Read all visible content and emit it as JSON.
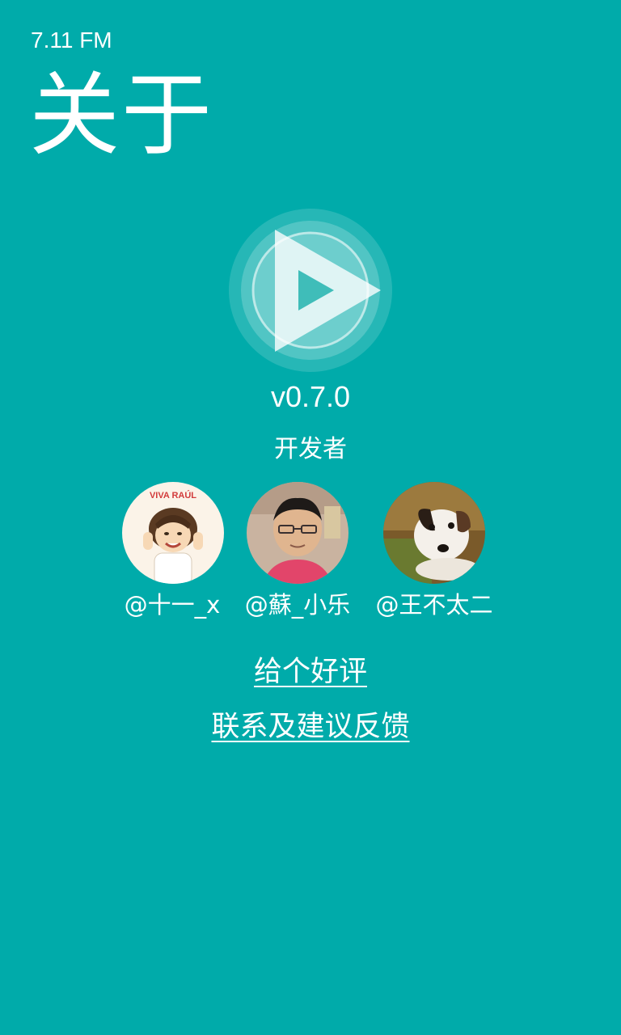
{
  "status_bar": {
    "time": "7.11 FM"
  },
  "header": {
    "title": "关于"
  },
  "app": {
    "logo_icon": "play-logo-icon",
    "version": "v0.7.0"
  },
  "developers": {
    "heading": "开发者",
    "items": [
      {
        "handle": "@十一_x",
        "avatar_icon": "cartoon-avatar",
        "avatar_text": "VIVA RAÚL"
      },
      {
        "handle": "@蘇_小乐",
        "avatar_icon": "photo-avatar"
      },
      {
        "handle": "@王不太二",
        "avatar_icon": "dog-avatar"
      }
    ]
  },
  "links": {
    "rate": "给个好评",
    "feedback": "联系及建议反馈"
  },
  "colors": {
    "background": "#00ABAA",
    "text": "#FFFFFF"
  }
}
